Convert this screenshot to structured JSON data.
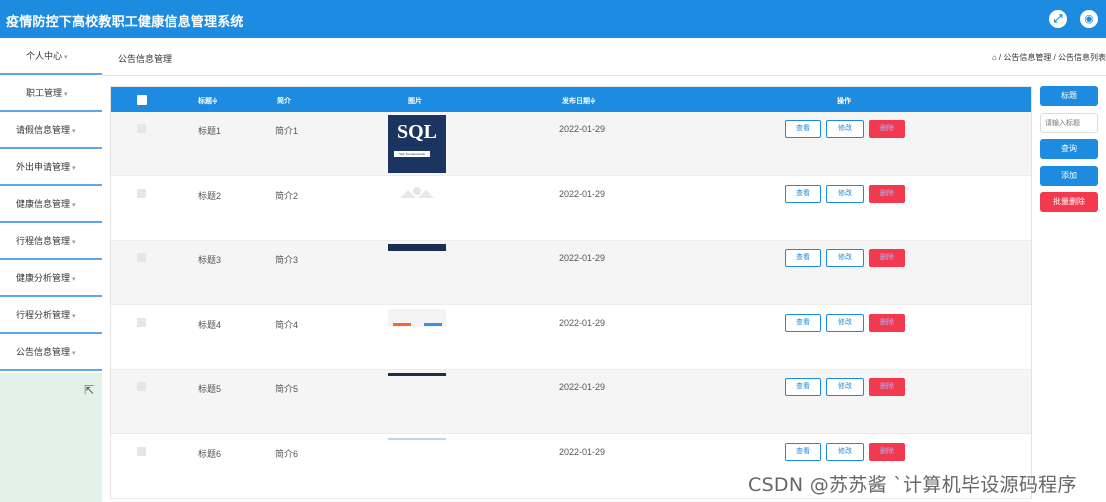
{
  "header": {
    "title": "疫情防控下高校教职工健康信息管理系统",
    "icons": [
      "fullscreen-icon",
      "user-icon"
    ]
  },
  "sidebar": {
    "items": [
      {
        "label": "个人中心"
      },
      {
        "label": "职工管理"
      },
      {
        "label": "请假信息管理"
      },
      {
        "label": "外出申请管理"
      },
      {
        "label": "健康信息管理"
      },
      {
        "label": "行程信息管理"
      },
      {
        "label": "健康分析管理"
      },
      {
        "label": "行程分析管理"
      },
      {
        "label": "公告信息管理"
      }
    ],
    "chevron": "▾"
  },
  "breadcrumb": {
    "page_name": "公告信息管理",
    "trail": "⌂ / 公告信息管理 / 公告信息列表"
  },
  "table": {
    "columns": [
      "标题≑",
      "简介",
      "图片",
      "发布日期≑",
      "操作"
    ],
    "rows": [
      {
        "title": "标题1",
        "intro": "简介1",
        "date": "2022-01-29",
        "image": "sql-book-cover"
      },
      {
        "title": "标题2",
        "intro": "简介2",
        "date": "2022-01-29",
        "image": "faded-graphic"
      },
      {
        "title": "标题3",
        "intro": "简介3",
        "date": "2022-01-29",
        "image": "dark-banner"
      },
      {
        "title": "标题4",
        "intro": "简介4",
        "date": "2022-01-29",
        "image": "color-bars"
      },
      {
        "title": "标题5",
        "intro": "简介5",
        "date": "2022-01-29",
        "image": "dark-strip"
      },
      {
        "title": "标题6",
        "intro": "简介6",
        "date": "2022-01-29",
        "image": "light-strip"
      }
    ],
    "actions": {
      "view": "查看",
      "edit": "修改",
      "delete": "删除"
    },
    "sql_cover": {
      "big": "SQL",
      "small": "SQL Fundamentals"
    }
  },
  "right_panel": {
    "label_button": "标题",
    "search_placeholder": "请输入标题",
    "query_button": "查询",
    "add_button": "添加",
    "batch_delete_button": "批量删除"
  },
  "watermark": "CSDN @苏苏酱   `计算机毕设源码程序",
  "colors": {
    "primary": "#1d8ce0",
    "danger": "#f2394f",
    "sidebar_fill": "#e3f2e9"
  }
}
